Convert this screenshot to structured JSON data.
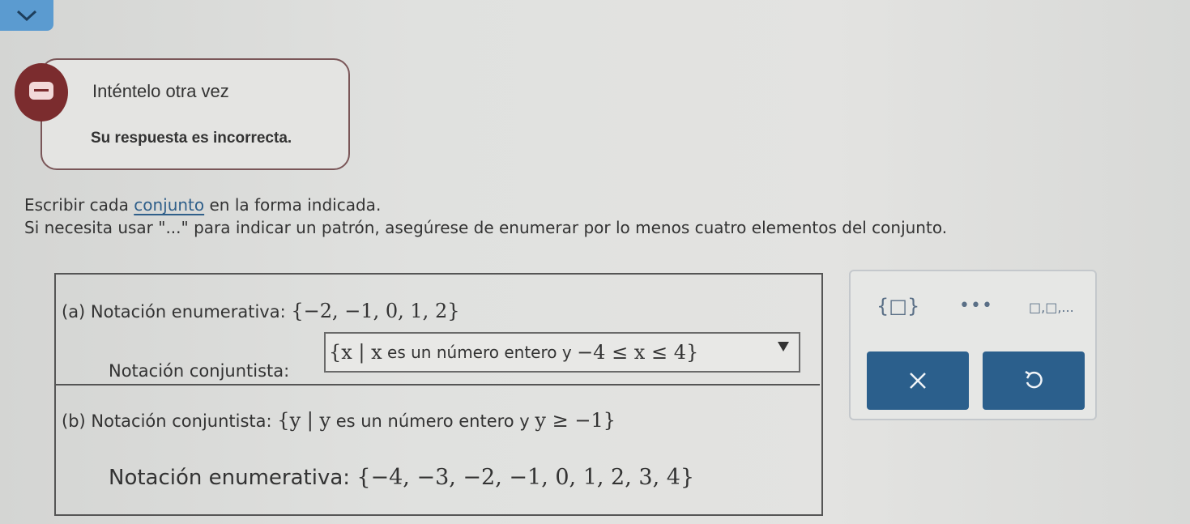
{
  "icons": {
    "collapse": "chevron-down-icon",
    "feedback": "speech-bubble-icon",
    "clear": "close-icon",
    "undo": "undo-icon"
  },
  "colors": {
    "accent": "#2b5f8c",
    "collapse_tab": "#5b9bd0",
    "feedback_icon": "#7b2c2e",
    "link": "#2f5f8a"
  },
  "feedback": {
    "title": "Inténtelo otra vez",
    "message": "Su respuesta es incorrecta."
  },
  "instructions": {
    "line1_before": "Escribir cada ",
    "line1_link": "conjunto",
    "line1_after": " en la forma indicada.",
    "line2": "Si necesita usar \"...\" para indicar un patrón, asegúrese de enumerar por lo menos cuatro elementos del conjunto."
  },
  "question_a": {
    "label": "(a)  Notación enumerativa: ",
    "set": "{−2, −1, 0, 1, 2}",
    "answer_label": "Notación conjuntista: ",
    "answer_math_1": "{x | x",
    "answer_text": " es un número entero y ",
    "answer_math_2": "−4 ≤ x ≤ 4}"
  },
  "question_b": {
    "label": "(b)  Notación conjuntista: ",
    "set_math_1": "{y | y",
    "set_text": " es un número entero y ",
    "set_math_2": "y ≥ −1}",
    "answer_label": "Notación enumerativa: ",
    "answer_math": "{−4, −3, −2, −1, 0, 1, 2, 3, 4}"
  },
  "toolbar": {
    "set_braces": "{□}",
    "ellipsis": "•••",
    "list_template": "□,□,..."
  }
}
